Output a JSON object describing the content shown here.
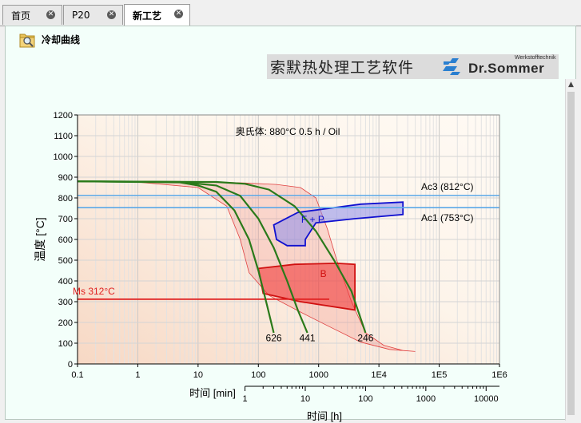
{
  "tabs": [
    {
      "label": "首页"
    },
    {
      "label": "P20"
    },
    {
      "label": "新工艺"
    }
  ],
  "panel": {
    "title": "冷却曲线"
  },
  "banner": {
    "text": "索默热处理工艺软件",
    "brand": "Dr.Sommer",
    "sub": "Werkstofftechnik"
  },
  "chart_data": {
    "type": "line",
    "title": "奥氏体: 880°C 0.5 h / Oil",
    "ylabel": "温度 [°C]",
    "xlabel_min": "时间 [min]",
    "xlabel_h": "时间 [h]",
    "xscale": "log",
    "xlim": [
      0.1,
      1000000
    ],
    "ylim": [
      0,
      1200
    ],
    "yticks": [
      0,
      100,
      200,
      300,
      400,
      500,
      600,
      700,
      800,
      900,
      1000,
      1100,
      1200
    ],
    "xticks_min": [
      {
        "v": 0.1,
        "label": "0.1"
      },
      {
        "v": 1,
        "label": "1"
      },
      {
        "v": 10,
        "label": "10"
      },
      {
        "v": 100,
        "label": "100"
      },
      {
        "v": 1000,
        "label": "1000"
      },
      {
        "v": 10000,
        "label": "1E4"
      },
      {
        "v": 100000,
        "label": "1E5"
      },
      {
        "v": 1000000,
        "label": "1E6"
      }
    ],
    "xticks_h": [
      {
        "v": 1,
        "label": "1"
      },
      {
        "v": 10,
        "label": "10"
      },
      {
        "v": 100,
        "label": "100"
      },
      {
        "v": 1000,
        "label": "1000"
      },
      {
        "v": 10000,
        "label": "10000"
      }
    ],
    "grid": true,
    "lines": [
      {
        "name": "Ac3 (812°C)",
        "y": 812,
        "color": "#5aa8e8"
      },
      {
        "name": "Ac1 (753°C)",
        "y": 753,
        "color": "#5aa8e8"
      },
      {
        "name": "Ms 312°C",
        "y": 312,
        "color": "#e02020"
      }
    ],
    "regions": [
      {
        "name": "",
        "fill": "rgba(240,110,100,0.22)",
        "stroke": "#e04040",
        "points": [
          [
            0.1,
            880
          ],
          [
            20,
            877
          ],
          [
            60,
            872
          ],
          [
            200,
            865
          ],
          [
            500,
            850
          ],
          [
            900,
            800
          ],
          [
            1400,
            650
          ],
          [
            2000,
            500
          ],
          [
            3500,
            300
          ],
          [
            6000,
            150
          ],
          [
            12000,
            90
          ],
          [
            25000,
            65
          ],
          [
            40000,
            60
          ],
          [
            15000,
            70
          ],
          [
            5000,
            105
          ],
          [
            1500,
            180
          ],
          [
            500,
            250
          ],
          [
            150,
            330
          ],
          [
            70,
            440
          ],
          [
            50,
            600
          ],
          [
            30,
            760
          ],
          [
            10,
            850
          ],
          [
            1,
            876
          ],
          [
            0.1,
            880
          ]
        ]
      },
      {
        "name": "F + P",
        "fill": "rgba(140,140,235,0.55)",
        "stroke": "#1010d0",
        "points": [
          [
            180,
            670
          ],
          [
            450,
            730
          ],
          [
            1500,
            750
          ],
          [
            5000,
            770
          ],
          [
            25000,
            780
          ],
          [
            25000,
            720
          ],
          [
            4000,
            700
          ],
          [
            900,
            680
          ],
          [
            600,
            600
          ],
          [
            600,
            570
          ],
          [
            300,
            570
          ],
          [
            200,
            600
          ],
          [
            180,
            670
          ]
        ]
      },
      {
        "name": "B",
        "fill": "rgba(240,60,60,0.6)",
        "stroke": "#d01010",
        "points": [
          [
            100,
            460
          ],
          [
            400,
            480
          ],
          [
            2000,
            485
          ],
          [
            4000,
            480
          ],
          [
            4000,
            260
          ],
          [
            500,
            300
          ],
          [
            120,
            340
          ],
          [
            100,
            460
          ]
        ]
      }
    ],
    "cooling_curves": [
      {
        "name": "626",
        "color": "#2a7a1a",
        "points": [
          [
            0.1,
            880
          ],
          [
            5,
            875
          ],
          [
            10,
            860
          ],
          [
            20,
            830
          ],
          [
            40,
            740
          ],
          [
            70,
            600
          ],
          [
            100,
            450
          ],
          [
            140,
            280
          ],
          [
            180,
            150
          ]
        ],
        "label_at": [
          180,
          110
        ]
      },
      {
        "name": "441",
        "color": "#2a7a1a",
        "points": [
          [
            0.1,
            880
          ],
          [
            5,
            877
          ],
          [
            20,
            860
          ],
          [
            50,
            810
          ],
          [
            100,
            700
          ],
          [
            180,
            560
          ],
          [
            300,
            400
          ],
          [
            450,
            260
          ],
          [
            650,
            150
          ]
        ],
        "label_at": [
          650,
          110
        ]
      },
      {
        "name": "246",
        "color": "#2a7a1a",
        "points": [
          [
            0.1,
            880
          ],
          [
            20,
            877
          ],
          [
            60,
            868
          ],
          [
            150,
            840
          ],
          [
            400,
            760
          ],
          [
            900,
            640
          ],
          [
            1800,
            500
          ],
          [
            3500,
            350
          ],
          [
            6000,
            150
          ]
        ],
        "label_at": [
          6000,
          110
        ]
      }
    ],
    "region_labels": [
      {
        "text": "F + P",
        "x": 800,
        "y": 680,
        "color": "#1010d0"
      },
      {
        "text": "B",
        "x": 1200,
        "y": 420,
        "color": "#d01010"
      }
    ]
  }
}
